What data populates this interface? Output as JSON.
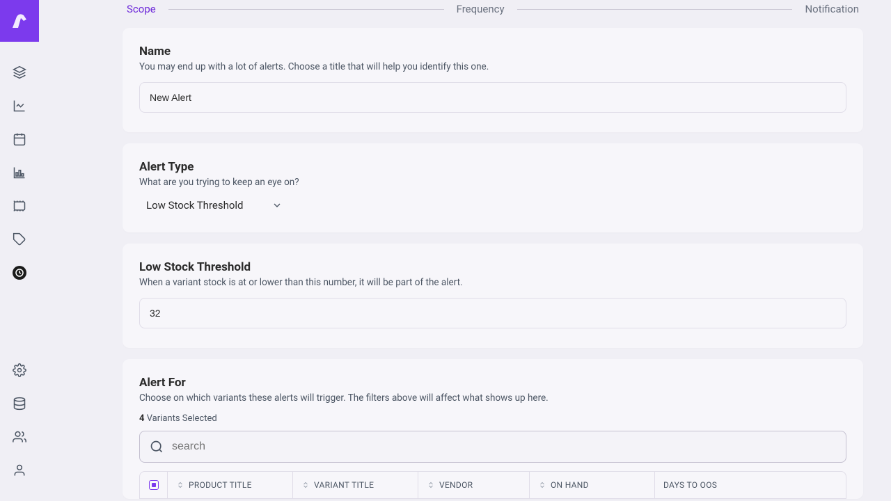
{
  "stepper": {
    "steps": [
      "Scope",
      "Frequency",
      "Notification"
    ],
    "activeIndex": 0
  },
  "nameCard": {
    "title": "Name",
    "desc": "You may end up with a lot of alerts. Choose a title that will help you identify this one.",
    "value": "New Alert"
  },
  "alertTypeCard": {
    "title": "Alert Type",
    "desc": "What are you trying to keep an eye on?",
    "selected": "Low Stock Threshold"
  },
  "thresholdCard": {
    "title": "Low Stock Threshold",
    "desc": "When a variant stock is at or lower than this number, it will be part of the alert.",
    "value": "32"
  },
  "alertForCard": {
    "title": "Alert For",
    "desc": "Choose on which variants these alerts will trigger. The filters above will affect what shows up here.",
    "selectedCount": "4",
    "selectedSuffix": " Variants Selected",
    "searchPlaceholder": "search",
    "columns": {
      "product": "PRODUCT TITLE",
      "variant": "VARIANT TITLE",
      "vendor": "VENDOR",
      "onhand": "ON HAND",
      "days": "DAYS TO OOS"
    }
  },
  "icons": {
    "layers": "layers-icon",
    "line-chart": "line-chart-icon",
    "calendar": "calendar-icon",
    "bar-chart": "bar-chart-icon",
    "grid": "grid-icon",
    "tag": "tag-icon",
    "clock": "clock-icon",
    "gear": "gear-icon",
    "database": "database-icon",
    "users": "users-icon",
    "user": "user-icon"
  }
}
